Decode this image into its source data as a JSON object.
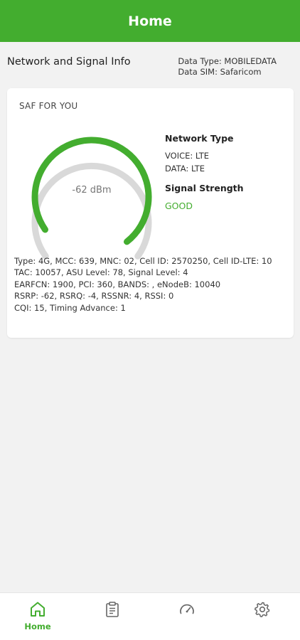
{
  "app_bar": {
    "title": "Home"
  },
  "info": {
    "title": "Network and Signal Info",
    "data_type": "Data Type: MOBILEDATA",
    "data_sim": "Data SIM: Safaricom"
  },
  "card": {
    "operator": "SAF FOR YOU",
    "gauge": {
      "value_label": "-62 dBm",
      "fill_fraction": 0.92
    },
    "network_type_heading": "Network Type",
    "voice": "VOICE: LTE",
    "data": "DATA: LTE",
    "signal_heading": "Signal Strength",
    "signal_value": "GOOD",
    "details": [
      "Type: 4G, MCC: 639, MNC: 02, Cell ID: 2570250, Cell ID-LTE: 10",
      "TAC: 10057, ASU Level: 78, Signal Level: 4",
      "EARFCN: 1900, PCI: 360, BANDS: , eNodeB: 10040",
      "RSRP: -62, RSRQ: -4, RSSNR: 4, RSSI: 0",
      "CQI: 15, Timing Advance: 1"
    ]
  },
  "bottom_nav": {
    "items": [
      {
        "label": "Home",
        "icon": "home-icon",
        "active": true
      },
      {
        "label": "",
        "icon": "clipboard-icon",
        "active": false
      },
      {
        "label": "",
        "icon": "speedometer-icon",
        "active": false
      },
      {
        "label": "",
        "icon": "gear-icon",
        "active": false
      }
    ]
  },
  "colors": {
    "accent": "#43ad2f",
    "gauge_track": "#d9d9d9"
  }
}
